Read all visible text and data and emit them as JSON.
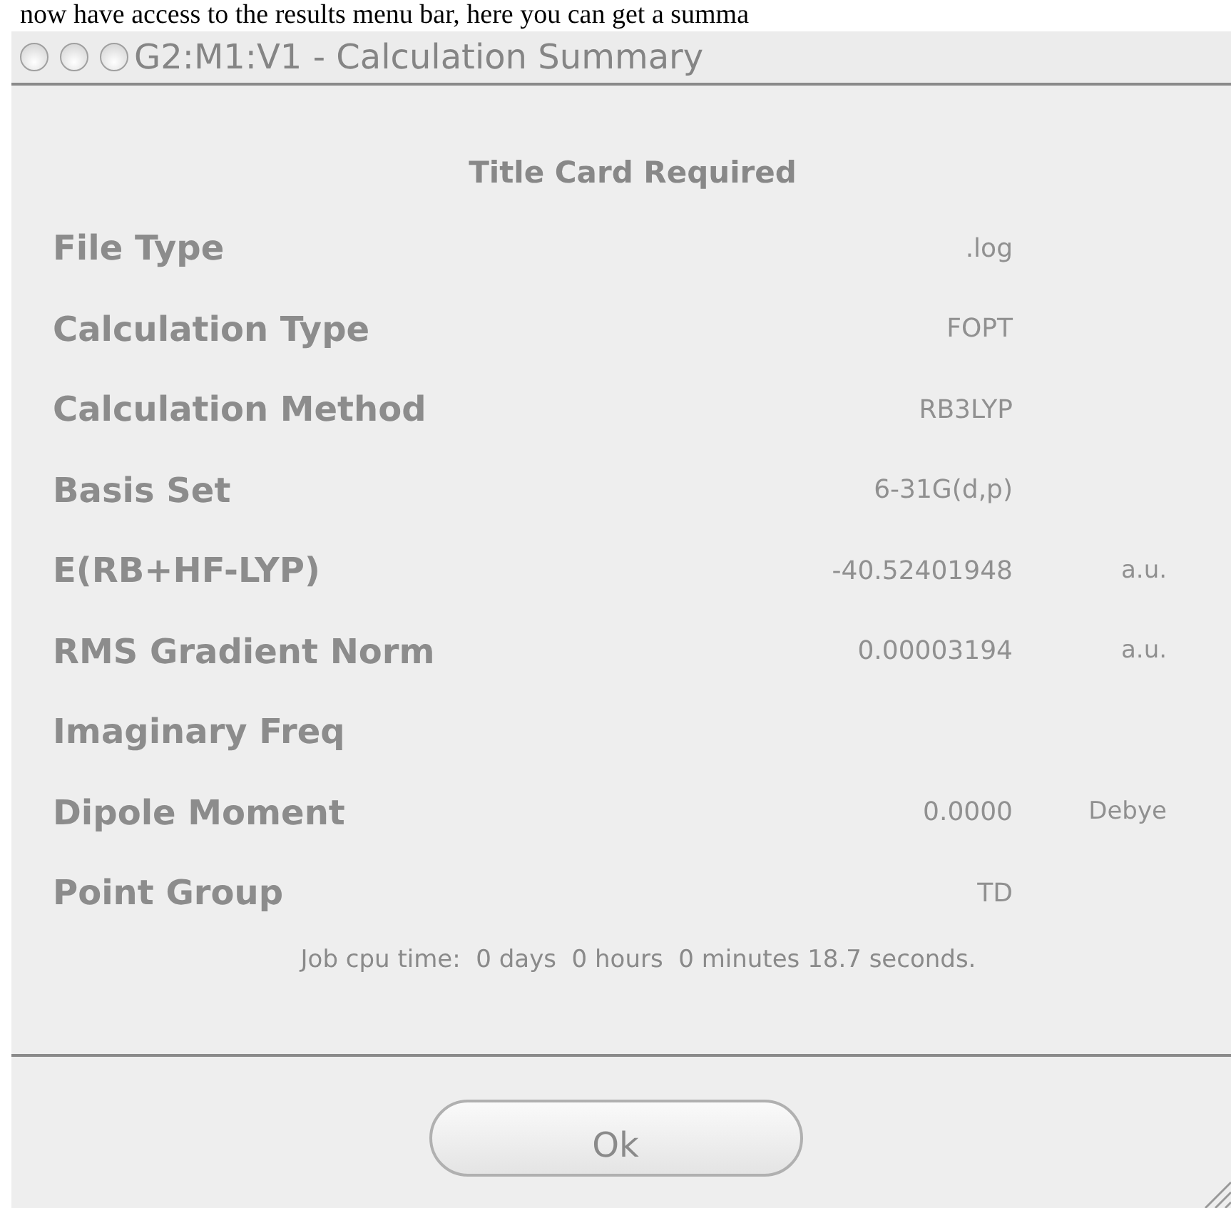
{
  "page_text": "now have access to the results menu bar, here you can get a summa",
  "window": {
    "title": "G2:M1:V1 - Calculation Summary"
  },
  "heading": "Title Card Required",
  "rows": [
    {
      "label": "File Type",
      "value": ".log"
    },
    {
      "label": "Calculation Type",
      "value": "FOPT"
    },
    {
      "label": "Calculation Method",
      "value": "RB3LYP"
    },
    {
      "label": "Basis Set",
      "value": "6-31G(d,p)"
    },
    {
      "label": "E(RB+HF-LYP)",
      "value": "-40.52401948",
      "unit": "a.u."
    },
    {
      "label": "RMS Gradient Norm",
      "value": "0.00003194",
      "unit": "a.u."
    },
    {
      "label": "Imaginary Freq"
    },
    {
      "label": "Dipole Moment",
      "value": "0.0000",
      "unit": "Debye"
    },
    {
      "label": "Point Group",
      "value": "TD"
    }
  ],
  "cpu_time": "Job cpu time:  0 days  0 hours  0 minutes 18.7 seconds.",
  "buttons": [
    "Ok"
  ]
}
